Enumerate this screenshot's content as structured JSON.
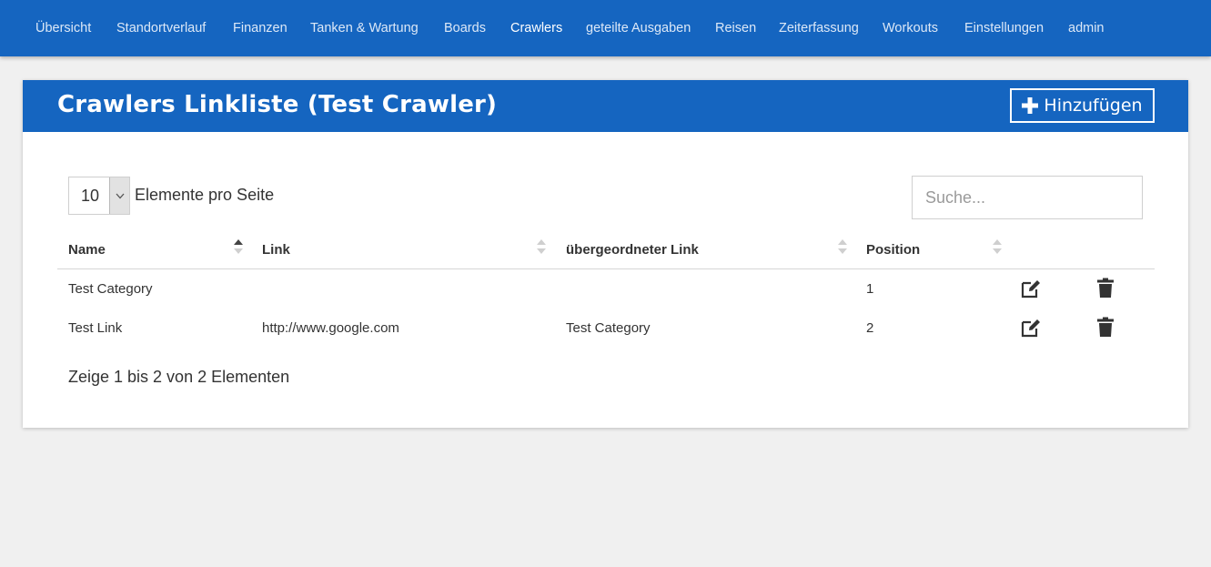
{
  "nav": {
    "items": [
      {
        "label": "Übersicht"
      },
      {
        "label": "Standortverlauf"
      },
      {
        "label": "Finanzen"
      },
      {
        "label": "Tanken & Wartung"
      },
      {
        "label": "Boards"
      },
      {
        "label": "Crawlers",
        "active": true
      },
      {
        "label": "geteilte Ausgaben"
      },
      {
        "label": "Reisen"
      },
      {
        "label": "Zeiterfassung"
      },
      {
        "label": "Workouts"
      },
      {
        "label": "Einstellungen"
      },
      {
        "label": "admin"
      }
    ]
  },
  "page": {
    "title": "Crawlers Linkliste (Test Crawler)",
    "add_button_label": "Hinzufügen"
  },
  "table_controls": {
    "page_length": "10",
    "page_length_label": "Elemente pro Seite",
    "search_placeholder": "Suche..."
  },
  "table": {
    "columns": [
      "Name",
      "Link",
      "übergeordneter Link",
      "Position"
    ],
    "sort": {
      "column": "Name",
      "direction": "asc"
    },
    "rows": [
      {
        "name": "Test Category",
        "link": "",
        "parent": "",
        "position": "1"
      },
      {
        "name": "Test Link",
        "link": "http://www.google.com",
        "parent": "Test Category",
        "position": "2"
      }
    ],
    "info": "Zeige 1 bis 2 von 2 Elementen"
  },
  "icons": {
    "add": "plus-icon",
    "edit": "edit-icon",
    "delete": "trash-icon",
    "sort": "sort-arrows-icon",
    "dropdown": "chevron-down-icon"
  },
  "colors": {
    "primary": "#1565c0",
    "background": "#f0f0f0",
    "card": "#ffffff",
    "text": "#333333"
  }
}
